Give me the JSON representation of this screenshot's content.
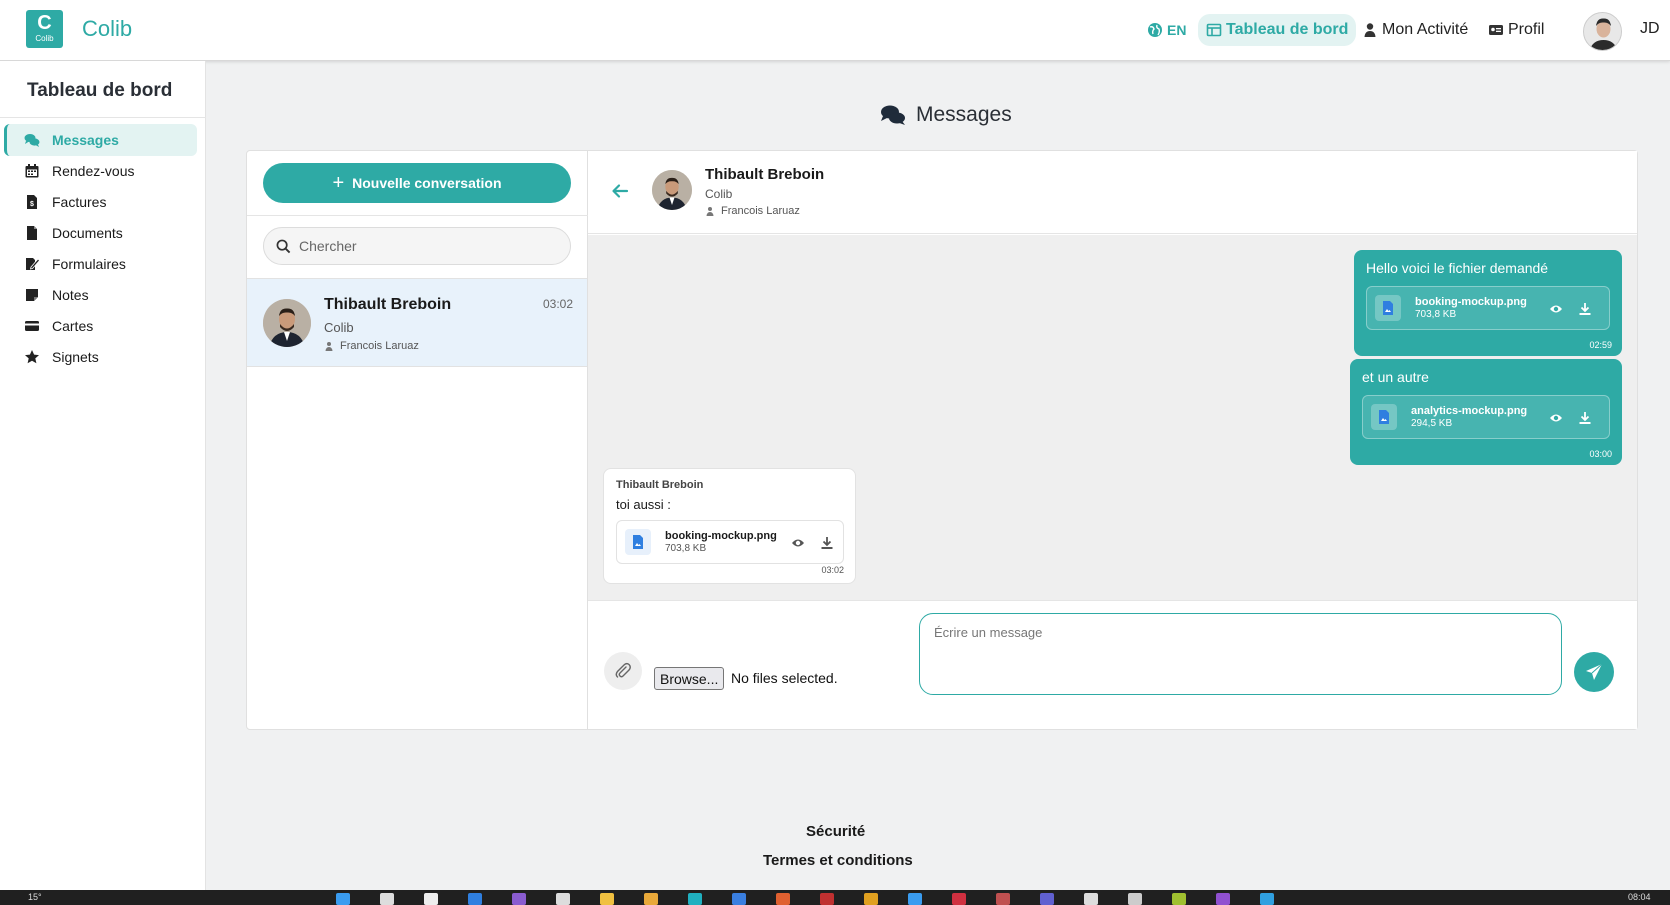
{
  "app": {
    "brand": "Colib",
    "logo_text": "Colib"
  },
  "topnav": {
    "lang": "EN",
    "dashboard": "Tableau de bord",
    "activity": "Mon Activité",
    "profile": "Profil",
    "initials": "JD"
  },
  "sidebar": {
    "title": "Tableau de bord",
    "items": [
      {
        "label": "Messages",
        "icon": "comments-icon",
        "active": true
      },
      {
        "label": "Rendez-vous",
        "icon": "calendar-icon"
      },
      {
        "label": "Factures",
        "icon": "invoice-icon"
      },
      {
        "label": "Documents",
        "icon": "file-icon"
      },
      {
        "label": "Formulaires",
        "icon": "form-edit-icon"
      },
      {
        "label": "Notes",
        "icon": "note-icon"
      },
      {
        "label": "Cartes",
        "icon": "credit-card-icon"
      },
      {
        "label": "Signets",
        "icon": "star-icon"
      }
    ]
  },
  "main": {
    "title": "Messages",
    "new_conversation": "Nouvelle conversation",
    "search_placeholder": "Chercher",
    "conversations": [
      {
        "name": "Thibault Breboin",
        "org": "Colib",
        "person": "Francois Laruaz",
        "time": "03:02"
      }
    ],
    "chat": {
      "contact": {
        "name": "Thibault Breboin",
        "org": "Colib",
        "person": "Francois Laruaz"
      },
      "messages": [
        {
          "direction": "out",
          "text": "Hello voici le fichier demandé",
          "file": "booking-mockup.png",
          "size": "703,8 KB",
          "time": "02:59"
        },
        {
          "direction": "out",
          "text": "et un autre",
          "file": "analytics-mockup.png",
          "size": "294,5 KB",
          "time": "03:00"
        },
        {
          "direction": "in",
          "sender": "Thibault Breboin",
          "text": "toi aussi :",
          "file": "booking-mockup.png",
          "size": "703,8 KB",
          "time": "03:02"
        }
      ],
      "composer": {
        "browse_label": "Browse...",
        "no_file": "No files selected.",
        "placeholder": "Écrire un message"
      }
    }
  },
  "footer": {
    "security": "Sécurité",
    "terms": "Termes et conditions"
  },
  "taskbar": {
    "temp": "15°",
    "clock": "08:04"
  },
  "colors": {
    "accent": "#2eaaa5",
    "selected_bg": "#e8f2fb",
    "chat_bg": "#efefef"
  }
}
